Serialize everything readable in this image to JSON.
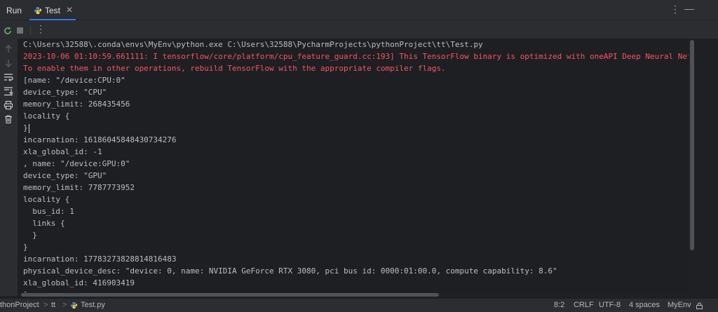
{
  "topbar": {
    "run_label": "Run",
    "tab_label": "Test",
    "tab_close": "✕",
    "more": "⋮",
    "minimize": "—"
  },
  "toolbar": {
    "more": "⋮"
  },
  "console": {
    "lines": [
      {
        "text": "C:\\Users\\32588\\.conda\\envs\\MyEnv\\python.exe C:\\Users\\32588\\PycharmProjects\\pythonProject\\tt\\Test.py",
        "kind": "normal"
      },
      {
        "text": "2023-10-06 01:10:59.661111: I tensorflow/core/platform/cpu_feature_guard.cc:193] This TensorFlow binary is optimized with oneAPI Deep Neural Network Library",
        "kind": "err"
      },
      {
        "text": "To enable them in other operations, rebuild TensorFlow with the appropriate compiler flags.",
        "kind": "err"
      },
      {
        "text": "[name: \"/device:CPU:0\"",
        "kind": "normal"
      },
      {
        "text": "device_type: \"CPU\"",
        "kind": "normal"
      },
      {
        "text": "memory_limit: 268435456",
        "kind": "normal"
      },
      {
        "text": "locality {",
        "kind": "normal"
      },
      {
        "text": "}",
        "kind": "normal"
      },
      {
        "text": "incarnation: 16186045848430734276",
        "kind": "normal"
      },
      {
        "text": "xla_global_id: -1",
        "kind": "normal"
      },
      {
        "text": ", name: \"/device:GPU:0\"",
        "kind": "normal"
      },
      {
        "text": "device_type: \"GPU\"",
        "kind": "normal"
      },
      {
        "text": "memory_limit: 7787773952",
        "kind": "normal"
      },
      {
        "text": "locality {",
        "kind": "normal"
      },
      {
        "text": "  bus_id: 1",
        "kind": "normal"
      },
      {
        "text": "  links {",
        "kind": "normal"
      },
      {
        "text": "  }",
        "kind": "normal"
      },
      {
        "text": "}",
        "kind": "normal"
      },
      {
        "text": "incarnation: 17783273828814816483",
        "kind": "normal"
      },
      {
        "text": "physical_device_desc: \"device: 0, name: NVIDIA GeForce RTX 3080, pci bus id: 0000:01:00.0, compute capability: 8.6\"",
        "kind": "normal"
      },
      {
        "text": "xla_global_id: 416903419",
        "kind": "normal"
      },
      {
        "text": "]",
        "kind": "normal"
      }
    ]
  },
  "statusbar": {
    "project": "thonProject",
    "sep1": ">",
    "folder": "tt",
    "sep2": ">",
    "file": "Test.py",
    "position": "8:2",
    "line_ending": "CRLF",
    "encoding": "UTF-8",
    "indent": "4 spaces",
    "interpreter": "MyEnv"
  },
  "colors": {
    "accent": "#3574f0",
    "error_text": "#f75464",
    "console_bg": "#1e1f22",
    "panel_bg": "#2b2d30"
  }
}
